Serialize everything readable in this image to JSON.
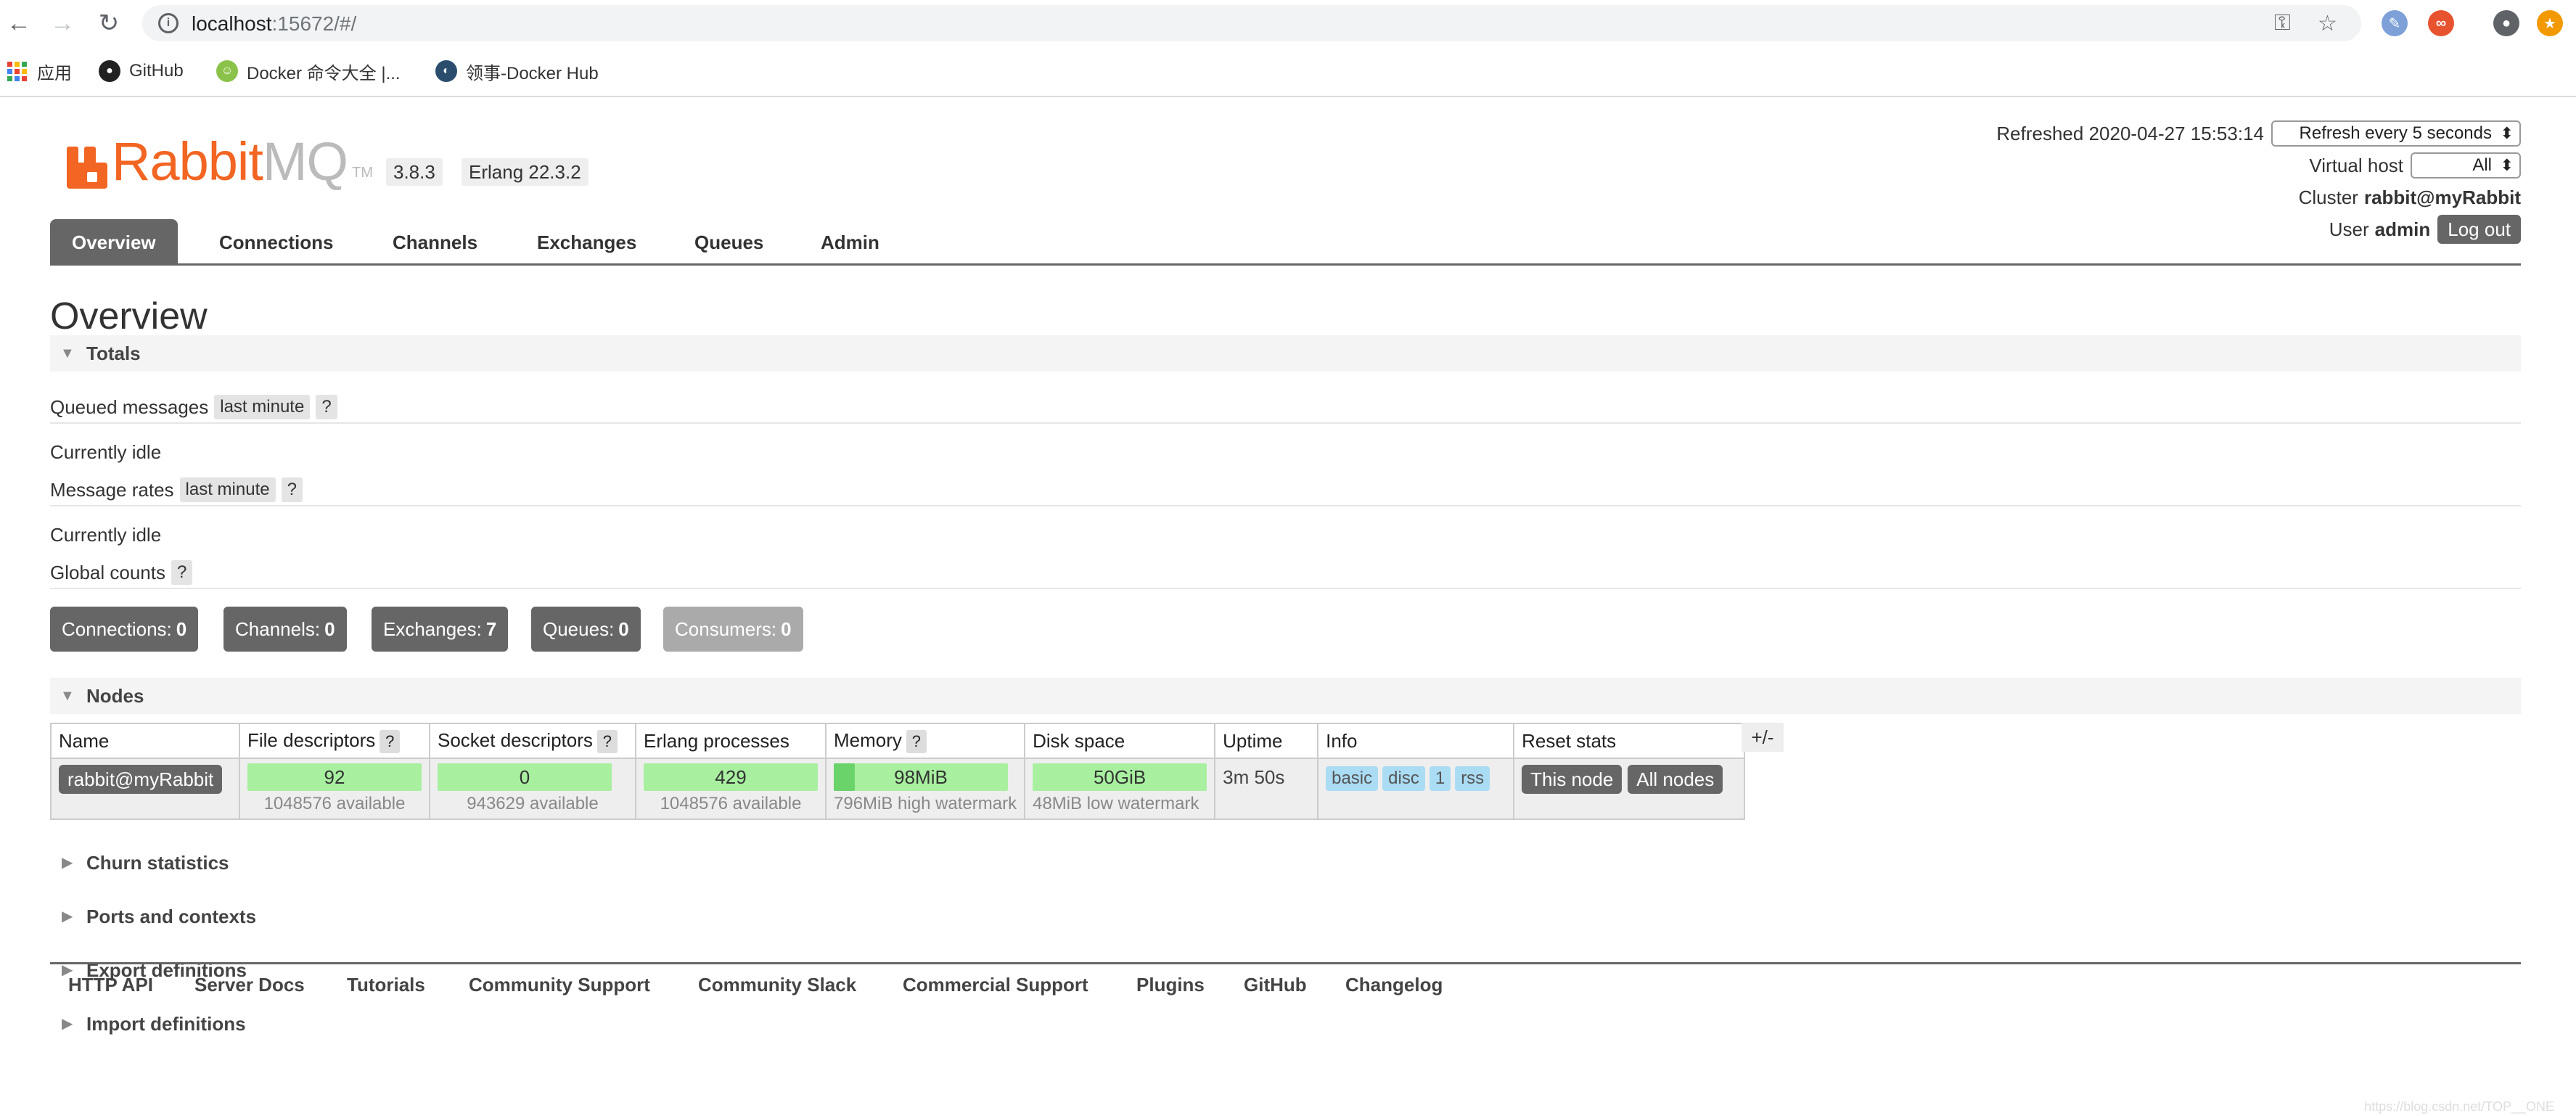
{
  "browser": {
    "url_host": "localhost",
    "url_rest": ":15672/#/",
    "bookmarks": [
      {
        "label": "应用"
      },
      {
        "label": "GitHub"
      },
      {
        "label": "Docker 命令大全 |..."
      },
      {
        "label": "领事-Docker Hub"
      }
    ]
  },
  "header": {
    "logo_rabbit": "Rabbit",
    "logo_mq": "MQ",
    "logo_tm": "TM",
    "version": "3.8.3",
    "erlang": "Erlang 22.3.2",
    "refreshed_label": "Refreshed 2020-04-27 15:53:14",
    "refresh_select": "Refresh every 5 seconds",
    "vhost_label": "Virtual host",
    "vhost_select": "All",
    "cluster_label": "Cluster",
    "cluster_name": "rabbit@myRabbit",
    "user_label": "User",
    "user_name": "admin",
    "logout_label": "Log out"
  },
  "tabs": [
    {
      "label": "Overview"
    },
    {
      "label": "Connections"
    },
    {
      "label": "Channels"
    },
    {
      "label": "Exchanges"
    },
    {
      "label": "Queues"
    },
    {
      "label": "Admin"
    }
  ],
  "page_title": "Overview",
  "totals": {
    "title": "Totals",
    "queued_label": "Queued messages",
    "queued_range": "last minute",
    "queued_state": "Currently idle",
    "rates_label": "Message rates",
    "rates_range": "last minute",
    "rates_state": "Currently idle",
    "global_label": "Global counts",
    "help": "?",
    "counts": [
      {
        "label": "Connections:",
        "value": "0"
      },
      {
        "label": "Channels:",
        "value": "0"
      },
      {
        "label": "Exchanges:",
        "value": "7"
      },
      {
        "label": "Queues:",
        "value": "0"
      },
      {
        "label": "Consumers:",
        "value": "0"
      }
    ]
  },
  "nodes": {
    "title": "Nodes",
    "columns": [
      "Name",
      "File descriptors",
      "Socket descriptors",
      "Erlang processes",
      "Memory",
      "Disk space",
      "Uptime",
      "Info",
      "Reset stats"
    ],
    "plusminus": "+/-",
    "row": {
      "name": "rabbit@myRabbit",
      "fd_used": "92",
      "fd_available": "1048576 available",
      "sd_used": "0",
      "sd_available": "943629 available",
      "ep_used": "429",
      "ep_available": "1048576 available",
      "memory": "98MiB",
      "memory_fraction": 0.12,
      "memory_watermark": "796MiB high watermark",
      "disk": "50GiB",
      "disk_watermark": "48MiB low watermark",
      "uptime": "3m 50s",
      "info_tags": [
        "basic",
        "disc",
        "1",
        "rss"
      ],
      "reset_this": "This node",
      "reset_all": "All nodes"
    }
  },
  "collapsed_sections": [
    {
      "label": "Churn statistics"
    },
    {
      "label": "Ports and contexts"
    },
    {
      "label": "Export definitions"
    },
    {
      "label": "Import definitions"
    }
  ],
  "footer": [
    {
      "label": "HTTP API"
    },
    {
      "label": "Server Docs"
    },
    {
      "label": "Tutorials"
    },
    {
      "label": "Community Support"
    },
    {
      "label": "Community Slack"
    },
    {
      "label": "Commercial Support"
    },
    {
      "label": "Plugins"
    },
    {
      "label": "GitHub"
    },
    {
      "label": "Changelog"
    }
  ],
  "watermark": "https://blog.csdn.net/TOP__ONE"
}
